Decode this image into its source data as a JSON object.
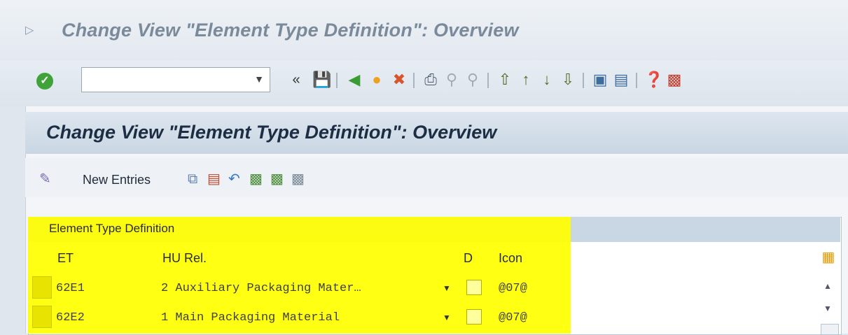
{
  "window": {
    "title": "Change View \"Element Type Definition\": Overview"
  },
  "toolbar": {
    "command_field_value": "",
    "nav_back": "«"
  },
  "screen": {
    "title": "Change View \"Element Type Definition\": Overview",
    "new_entries_label": "New Entries"
  },
  "table": {
    "caption": "Element Type Definition",
    "columns": [
      "ET",
      "HU Rel.",
      "D",
      "Icon"
    ],
    "rows": [
      {
        "et": "62E1",
        "hu_rel": "2 Auxiliary Packaging Mater…",
        "d": false,
        "icon": "@07@"
      },
      {
        "et": "62E2",
        "hu_rel": "1 Main Packaging Material",
        "d": false,
        "icon": "@07@"
      }
    ]
  },
  "colors": {
    "highlight": "#ffff00",
    "title_text": "#1c2d44"
  }
}
